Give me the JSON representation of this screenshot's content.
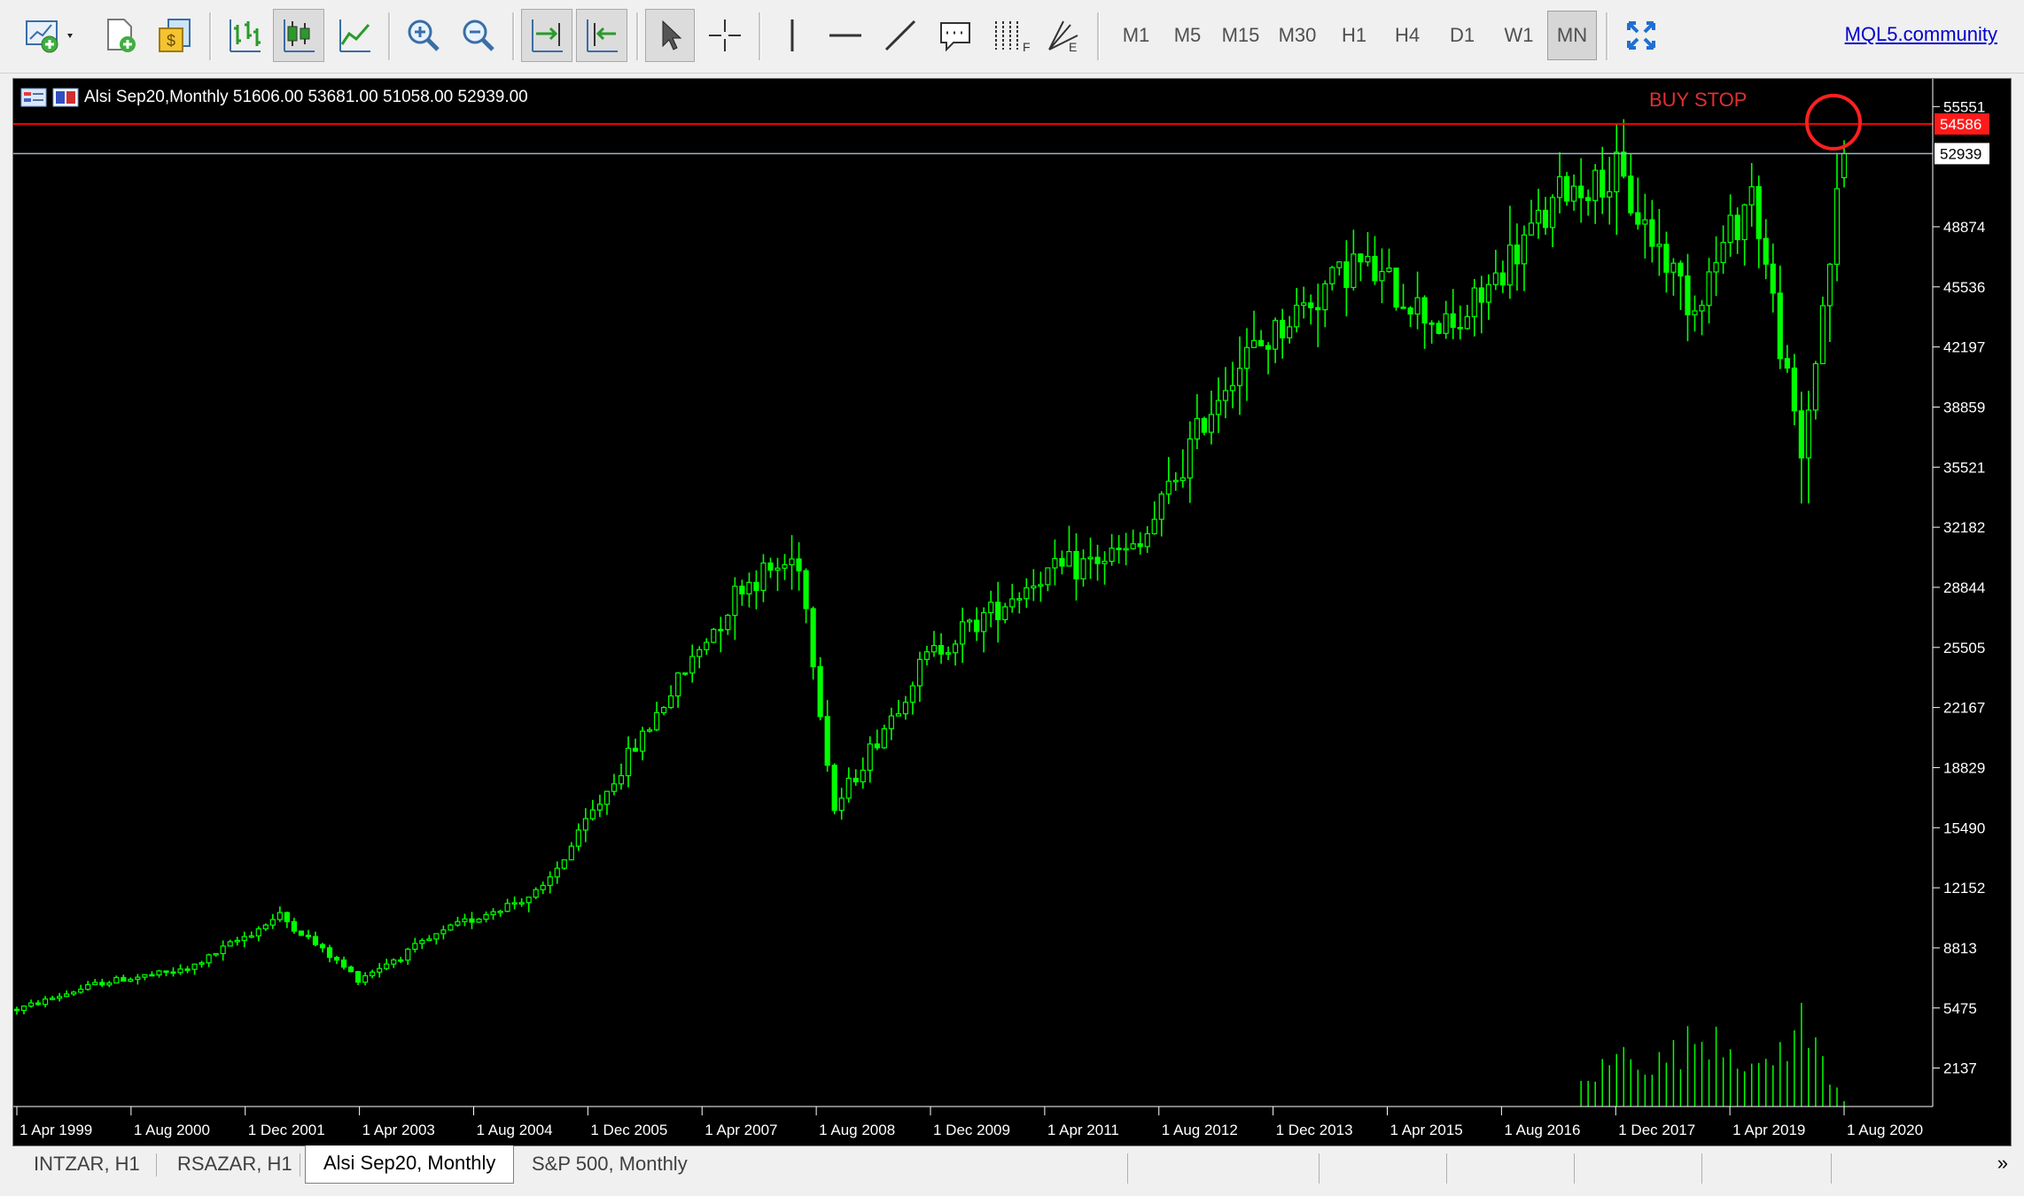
{
  "toolbar": {
    "timeframes": [
      "M1",
      "M5",
      "M15",
      "M30",
      "H1",
      "H4",
      "D1",
      "W1",
      "MN"
    ],
    "active_timeframe": "MN",
    "community_link": "MQL5.community",
    "icons": [
      "new-chart-icon",
      "new-order-icon",
      "market-watch-icon",
      "bar-chart-icon",
      "candlestick-chart-icon",
      "line-chart-icon",
      "zoom-in-icon",
      "zoom-out-icon",
      "autoscroll-icon",
      "chart-shift-icon",
      "cursor-icon",
      "crosshair-icon",
      "vertical-line-icon",
      "horizontal-line-icon",
      "trendline-icon",
      "text-icon",
      "fibonacci-icon",
      "gann-icon",
      "fullscreen-icon"
    ]
  },
  "chart": {
    "header": "Alsi Sep20,Monthly  51606.00 53681.00 51058.00 52939.00",
    "annotation": "BUY STOP",
    "colors": {
      "background": "#000000",
      "candles": "#00ff00",
      "buy_stop_line": "#ff0000",
      "bid_line": "#9db3c4",
      "axis_text": "#ffffff"
    }
  },
  "chart_data": {
    "type": "candlestick",
    "title": "Alsi Sep20,Monthly",
    "ohlc_last": {
      "open": 51606.0,
      "high": 53681.0,
      "low": 51058.0,
      "close": 52939.0
    },
    "buy_stop_price": "54586",
    "current_price": "52939",
    "ylim": [
      0,
      56600
    ],
    "y_ticks": [
      "55551",
      "48874",
      "45536",
      "42197",
      "38859",
      "35521",
      "32182",
      "28844",
      "25505",
      "22167",
      "18829",
      "15490",
      "12152",
      "8813",
      "5475",
      "2137"
    ],
    "x_ticks": [
      "1 Apr 1999",
      "1 Aug 2000",
      "1 Dec 2001",
      "1 Apr 2003",
      "1 Aug 2004",
      "1 Dec 2005",
      "1 Apr 2007",
      "1 Aug 2008",
      "1 Dec 2009",
      "1 Apr 2011",
      "1 Aug 2012",
      "1 Dec 2013",
      "1 Apr 2015",
      "1 Aug 2016",
      "1 Dec 2017",
      "1 Apr 2019",
      "1 Aug 2020"
    ],
    "close_path": [
      [
        "1999-04",
        5400
      ],
      [
        "2000-04",
        6900
      ],
      [
        "2001-04",
        7600
      ],
      [
        "2002-05",
        10600
      ],
      [
        "2003-04",
        7100
      ],
      [
        "2004-06",
        10100
      ],
      [
        "2005-06",
        12000
      ],
      [
        "2006-06",
        19400
      ],
      [
        "2007-10",
        29000
      ],
      [
        "2008-06",
        30500
      ],
      [
        "2008-11",
        16500
      ],
      [
        "2009-12",
        25000
      ],
      [
        "2011-04",
        29500
      ],
      [
        "2012-06",
        31000
      ],
      [
        "2013-06",
        40500
      ],
      [
        "2014-12",
        47000
      ],
      [
        "2016-02",
        43000
      ],
      [
        "2017-06",
        51000
      ],
      [
        "2018-01",
        51500
      ],
      [
        "2018-12",
        44500
      ],
      [
        "2019-08",
        51000
      ],
      [
        "2020-03",
        36000
      ],
      [
        "2020-09",
        52939
      ]
    ],
    "volume_path": [
      [
        "2017-08",
        1300
      ],
      [
        "2018-03",
        3400
      ],
      [
        "2018-06",
        2300
      ],
      [
        "2019-03",
        4600
      ],
      [
        "2019-09",
        1900
      ],
      [
        "2020-03",
        4800
      ],
      [
        "2020-09",
        400
      ]
    ]
  },
  "tabs": {
    "items": [
      "INTZAR, H1",
      "RSAZAR, H1",
      "Alsi Sep20, Monthly",
      "S&P 500, Monthly"
    ],
    "active": "Alsi Sep20, Monthly",
    "scroll_label": "»"
  }
}
